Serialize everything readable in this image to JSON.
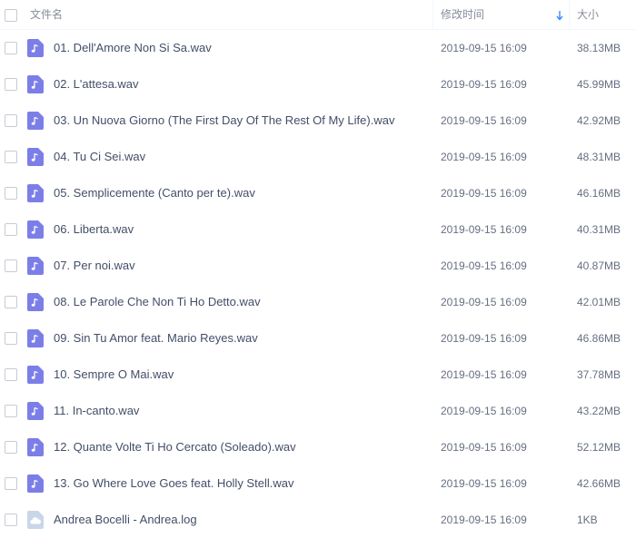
{
  "header": {
    "name_col": "文件名",
    "modified_col": "修改时间",
    "size_col": "大小",
    "sort_direction": "descending"
  },
  "files": [
    {
      "name": "01. Dell'Amore Non Si Sa.wav",
      "modified": "2019-09-15 16:09",
      "size": "38.13MB",
      "icon": "audio-file-icon"
    },
    {
      "name": "02. L'attesa.wav",
      "modified": "2019-09-15 16:09",
      "size": "45.99MB",
      "icon": "audio-file-icon"
    },
    {
      "name": "03. Un Nuova Giorno (The First Day Of The Rest Of My Life).wav",
      "modified": "2019-09-15 16:09",
      "size": "42.92MB",
      "icon": "audio-file-icon"
    },
    {
      "name": "04. Tu Ci Sei.wav",
      "modified": "2019-09-15 16:09",
      "size": "48.31MB",
      "icon": "audio-file-icon"
    },
    {
      "name": "05. Semplicemente (Canto per te).wav",
      "modified": "2019-09-15 16:09",
      "size": "46.16MB",
      "icon": "audio-file-icon"
    },
    {
      "name": "06. Liberta.wav",
      "modified": "2019-09-15 16:09",
      "size": "40.31MB",
      "icon": "audio-file-icon"
    },
    {
      "name": "07. Per noi.wav",
      "modified": "2019-09-15 16:09",
      "size": "40.87MB",
      "icon": "audio-file-icon"
    },
    {
      "name": "08. Le Parole Che Non Ti Ho Detto.wav",
      "modified": "2019-09-15 16:09",
      "size": "42.01MB",
      "icon": "audio-file-icon"
    },
    {
      "name": "09. Sin Tu Amor feat. Mario Reyes.wav",
      "modified": "2019-09-15 16:09",
      "size": "46.86MB",
      "icon": "audio-file-icon"
    },
    {
      "name": "10. Sempre O Mai.wav",
      "modified": "2019-09-15 16:09",
      "size": "37.78MB",
      "icon": "audio-file-icon"
    },
    {
      "name": "11. In-canto.wav",
      "modified": "2019-09-15 16:09",
      "size": "43.22MB",
      "icon": "audio-file-icon"
    },
    {
      "name": "12. Quante Volte Ti Ho Cercato (Soleado).wav",
      "modified": "2019-09-15 16:09",
      "size": "52.12MB",
      "icon": "audio-file-icon"
    },
    {
      "name": "13. Go Where Love Goes feat. Holly Stell.wav",
      "modified": "2019-09-15 16:09",
      "size": "42.66MB",
      "icon": "audio-file-icon"
    },
    {
      "name": "Andrea Bocelli - Andrea.log",
      "modified": "2019-09-15 16:09",
      "size": "1KB",
      "icon": "cloud-file-icon"
    }
  ],
  "colors": {
    "audio_icon": "#7c7ee8",
    "cloud_icon": "#c9d6e8",
    "sort_arrow": "#3b8cff"
  }
}
